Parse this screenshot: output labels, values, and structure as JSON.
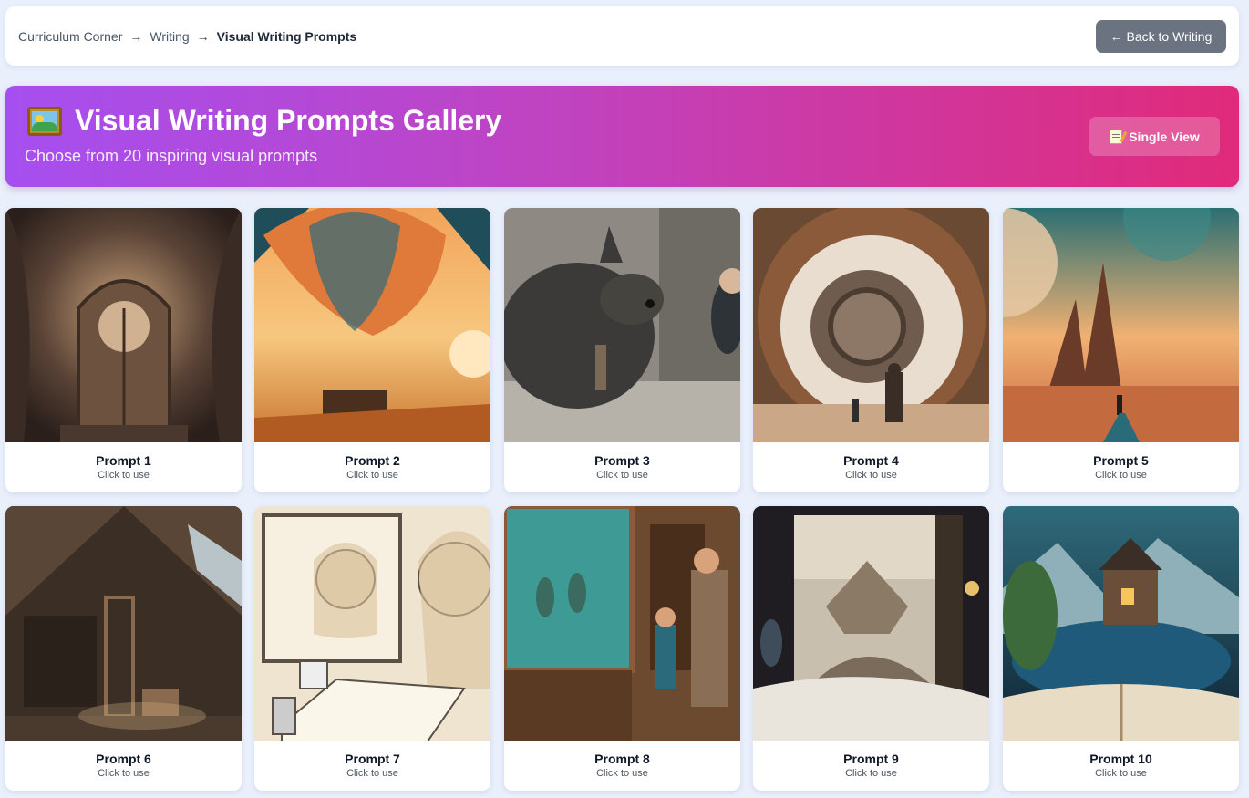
{
  "breadcrumb": {
    "items": [
      "Curriculum Corner",
      "Writing"
    ],
    "separator": "→",
    "current": "Visual Writing Prompts"
  },
  "back_button": {
    "label": "← Back to Writing"
  },
  "hero": {
    "icon": "framed-picture-icon",
    "title": "Visual Writing Prompts Gallery",
    "subtitle": "Choose from 20 inspiring visual prompts",
    "single_view_label": "Single View",
    "single_view_icon": "memo-icon"
  },
  "colors": {
    "gradient_start": "#a64ff0",
    "gradient_end": "#e02a7a",
    "back_button": "#6b7280",
    "page_bg": "#e9effb"
  },
  "prompts": [
    {
      "label": "Prompt 1",
      "hint": "Click to use",
      "scene": "ornate wooden door in a giant tree"
    },
    {
      "label": "Prompt 2",
      "hint": "Click to use",
      "scene": "hot air balloon over a desert at sunset"
    },
    {
      "label": "Prompt 3",
      "hint": "Click to use",
      "scene": "giant furry creature meeting a boy"
    },
    {
      "label": "Prompt 4",
      "hint": "Click to use",
      "scene": "giant steampunk gear portal"
    },
    {
      "label": "Prompt 5",
      "hint": "Click to use",
      "scene": "alien planet landscape with moons"
    },
    {
      "label": "Prompt 6",
      "hint": "Click to use",
      "scene": "dusty attic with ladder"
    },
    {
      "label": "Prompt 7",
      "hint": "Click to use",
      "scene": "girl drawing by a window sketch"
    },
    {
      "label": "Prompt 8",
      "hint": "Click to use",
      "scene": "child and grandparent at museum birds display"
    },
    {
      "label": "Prompt 9",
      "hint": "Click to use",
      "scene": "doorway opening to a floating city"
    },
    {
      "label": "Prompt 10",
      "hint": "Click to use",
      "scene": "castle rising from an open book"
    }
  ]
}
